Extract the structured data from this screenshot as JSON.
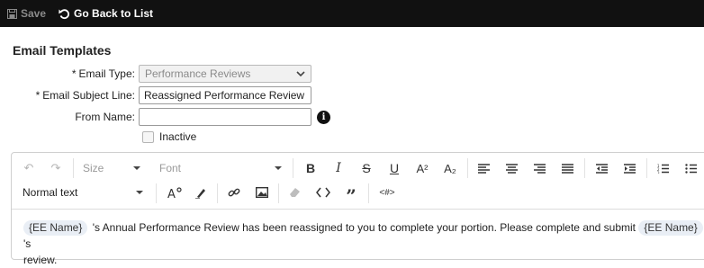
{
  "toolbar": {
    "save_label": "Save",
    "back_label": "Go Back to List"
  },
  "page": {
    "title": "Email Templates"
  },
  "form": {
    "email_type": {
      "label": "Email Type:",
      "required_mark": "*",
      "value": "Performance Reviews"
    },
    "subject": {
      "label": "Email Subject Line:",
      "required_mark": "*",
      "value": "Reassigned Performance Review"
    },
    "from_name": {
      "label": "From Name:",
      "value": "",
      "info_icon": "i"
    },
    "inactive": {
      "label": "Inactive",
      "checked": false
    }
  },
  "editor": {
    "size_label": "Size",
    "font_label": "Font",
    "paragraph_label": "Normal text",
    "icons": {
      "undo": "↶",
      "redo": "↷",
      "bold": "B",
      "italic": "I",
      "strike": "S",
      "underline": "U",
      "superscript": "A²",
      "subscript": "A₂",
      "quote": "”",
      "code_block": "<#>"
    },
    "body": {
      "tag1": "{EE Name}",
      "text1": "'s Annual Performance Review has been reassigned to you to complete your portion. Please complete and submit",
      "tag2": "{EE Name}",
      "text2": "'s",
      "text3": "review."
    }
  }
}
